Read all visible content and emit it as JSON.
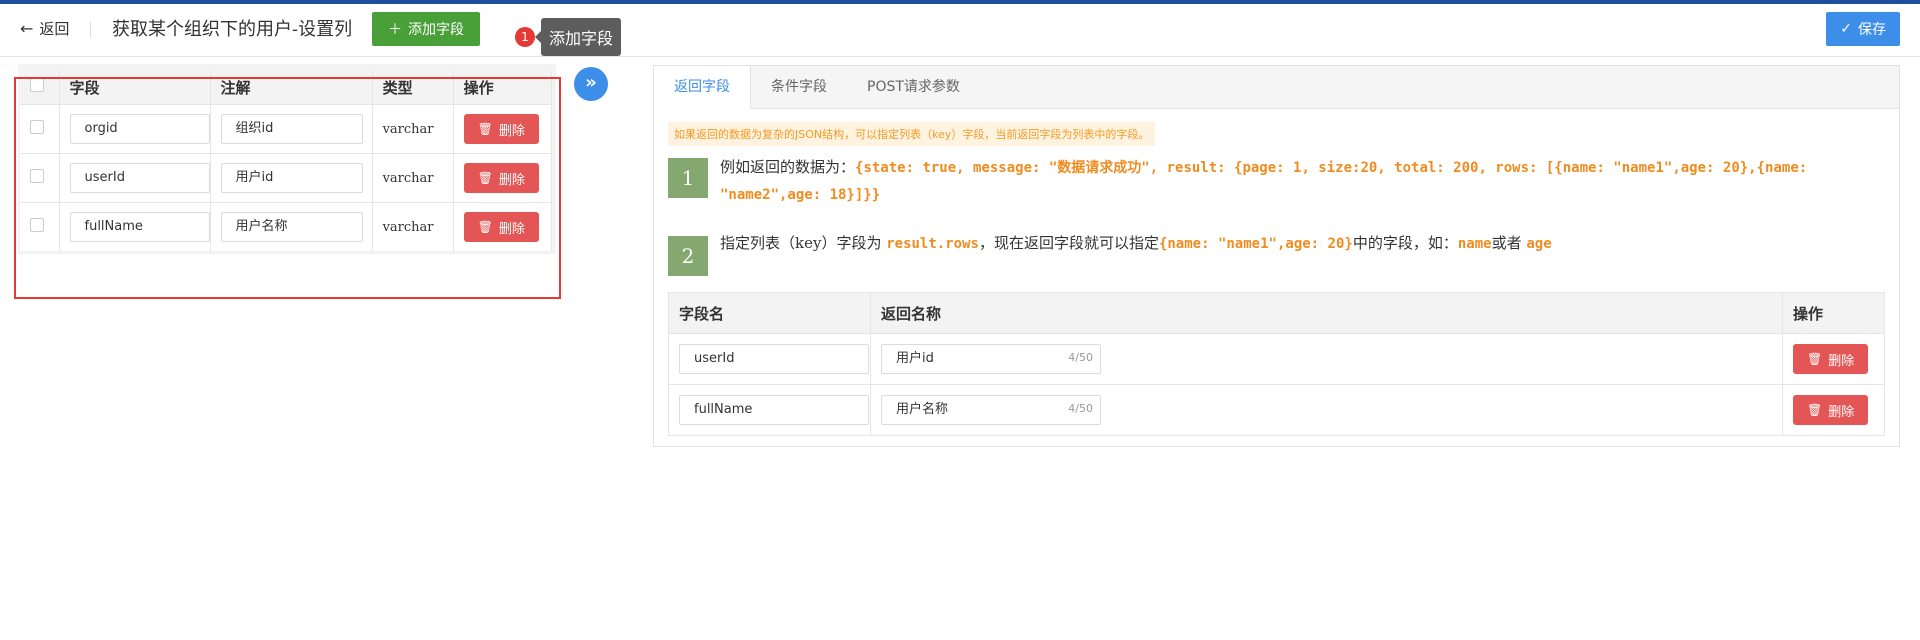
{
  "header": {
    "back_label": "返回",
    "title": "获取某个组织下的用户-设置列",
    "add_field_label": "添加字段",
    "badge": "1",
    "tooltip": "添加字段",
    "save_label": "保存"
  },
  "left_table": {
    "columns": [
      "字段",
      "注解",
      "类型",
      "操作"
    ],
    "rows": [
      {
        "field": "orgid",
        "note": "组织id",
        "type": "varchar",
        "action": "删除"
      },
      {
        "field": "userId",
        "note": "用户id",
        "type": "varchar",
        "action": "删除"
      },
      {
        "field": "fullName",
        "note": "用户名称",
        "type": "varchar",
        "action": "删除"
      }
    ]
  },
  "right_panel": {
    "tabs": [
      "返回字段",
      "条件字段",
      "POST请求参数"
    ],
    "active_tab": "返回字段",
    "hint": "如果返回的数据为复杂的JSON结构，可以指定列表（key）字段，当前返回字段为列表中的字段。",
    "step1": {
      "num": "1",
      "text": "例如返回的数据为：",
      "code": "{state: true, message: \"数据请求成功\", result: {page: 1, size:20, total: 200, rows: [{name: \"name1\",age: 20},{name: \"name2\",age: 18}]}}"
    },
    "step2": {
      "num": "2",
      "text_a": "指定列表（key）字段为 ",
      "code_a": "result.rows",
      "text_b": "，现在返回字段就可以指定",
      "code_b": "{name: \"name1\",age: 20}",
      "text_c": "中的字段，如：",
      "code_c": "name",
      "text_d": "或者 ",
      "code_d": "age"
    },
    "table": {
      "columns": [
        "字段名",
        "返回名称",
        "操作"
      ],
      "rows": [
        {
          "field": "userId",
          "name": "用户id",
          "count": "4/50",
          "action": "删除"
        },
        {
          "field": "fullName",
          "name": "用户名称",
          "count": "4/50",
          "action": "删除"
        }
      ]
    }
  }
}
